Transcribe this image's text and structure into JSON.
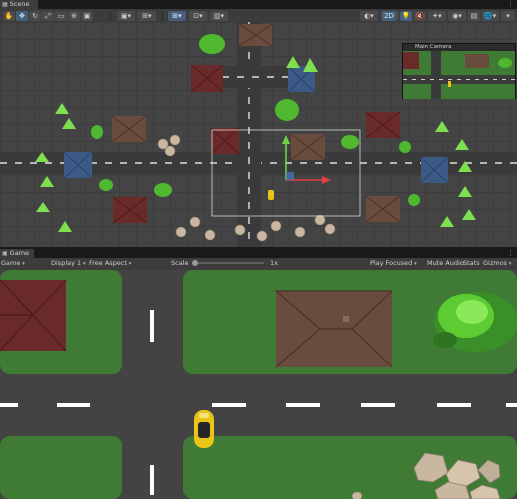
{
  "scene_tab": {
    "label": "Scene"
  },
  "game_tab": {
    "label": "Game"
  },
  "scene_toolbar": {
    "tools": [
      "hand-tool",
      "move-tool",
      "rotate-tool",
      "scale-tool",
      "rect-tool",
      "transform-tool"
    ],
    "mode_2d_label": "2D"
  },
  "game_toolbar": {
    "view_select": "Game",
    "display_select": "Display 1",
    "aspect_select": "Free Aspect",
    "scale_label": "Scale",
    "scale_value": "1x",
    "play_mode_select": "Play Focused",
    "mute_audio_label": "Mute Audio",
    "stats_label": "Stats",
    "gizmos_select": "Gizmos"
  },
  "camera_preview": {
    "title": "Main Camera"
  },
  "colors": {
    "grass": "#3f7b35",
    "road": "#3a3a3a",
    "lane_marking": "#ffffff",
    "car": "#e9c517",
    "house_red": "#6b2a2a",
    "house_brown": "#6a4c3f",
    "house_blue": "#3c5a86",
    "tree": "#4fb82f",
    "selection_outline": "#d8d8d8",
    "gizmo_x": "#e04040",
    "gizmo_y": "#6dd44a",
    "active_tab": "#46607c"
  }
}
